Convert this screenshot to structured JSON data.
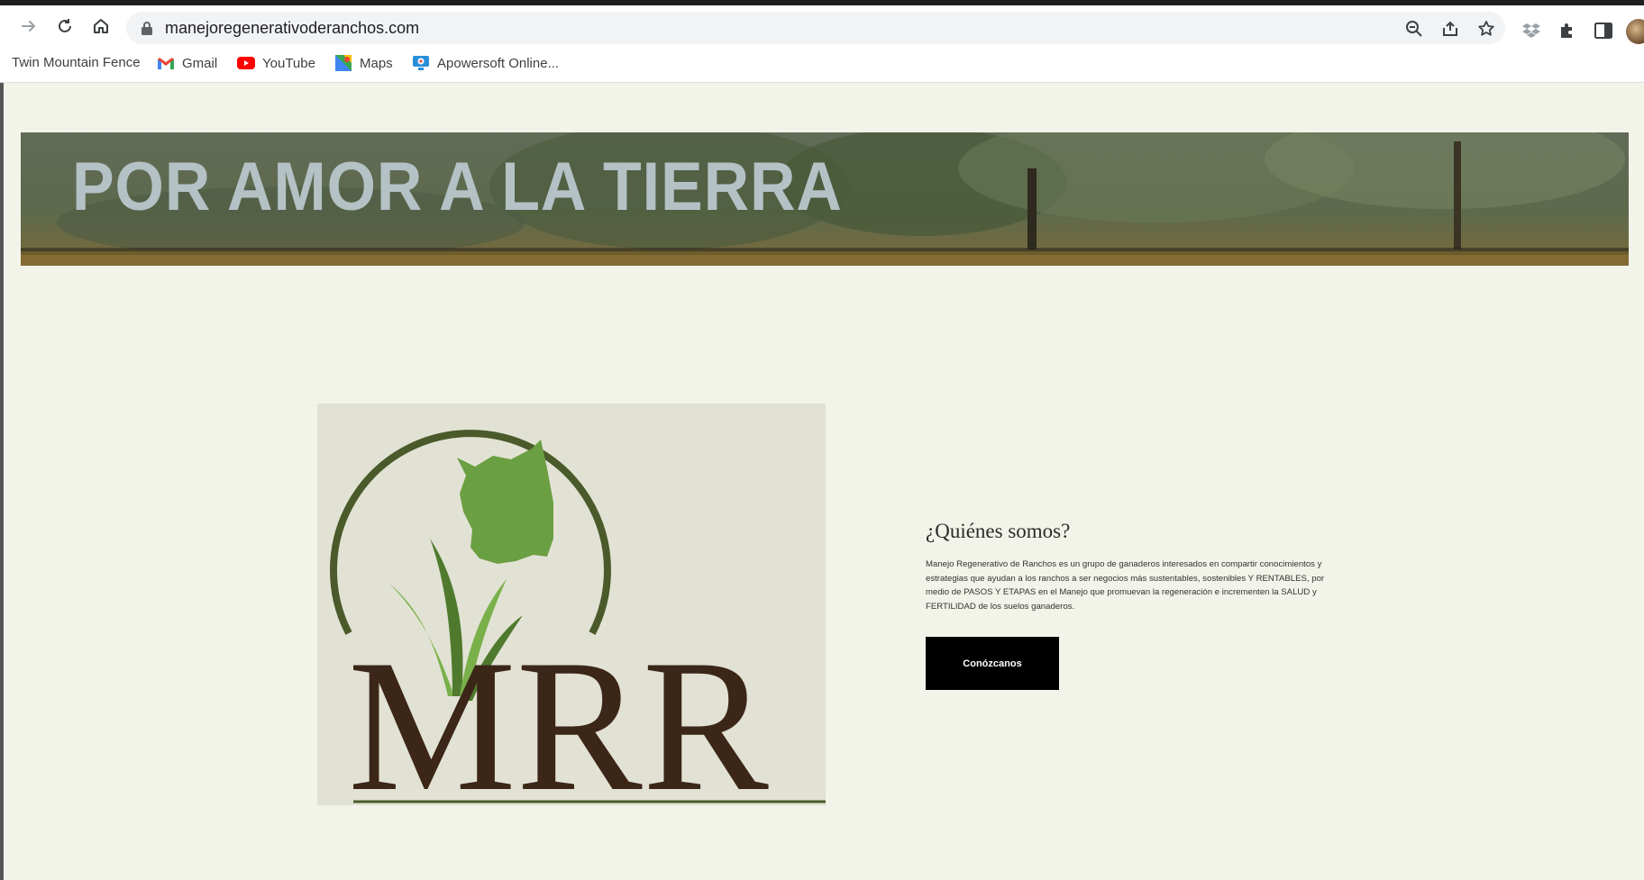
{
  "browser": {
    "url": "manejoregenerativoderanchos.com",
    "nav_icons": [
      "forward-icon",
      "reload-icon",
      "home-icon"
    ],
    "omnibox_icons": [
      "zoom-icon",
      "share-icon",
      "bookmark-star-icon"
    ],
    "extension_icons": [
      "dropbox-icon",
      "extensions-puzzle-icon",
      "side-panel-icon"
    ]
  },
  "bookmarks": [
    {
      "label": "Twin Mountain Fence",
      "icon": "none"
    },
    {
      "label": "Gmail",
      "icon": "gmail-icon"
    },
    {
      "label": "YouTube",
      "icon": "youtube-icon"
    },
    {
      "label": "Maps",
      "icon": "maps-icon"
    },
    {
      "label": "Apowersoft Online...",
      "icon": "apowersoft-icon"
    }
  ],
  "banner": {
    "title": "POR AMOR A LA TIERRA"
  },
  "logo": {
    "text": "MRR",
    "colors": {
      "ring": "#4a5a2a",
      "cow": "#6a9f42",
      "grass_light": "#7ab04a",
      "grass_dark": "#4f7a2e",
      "letters": "#3b2618"
    }
  },
  "about": {
    "title": "¿Quiénes somos?",
    "text": "Manejo Regenerativo de Ranchos es un grupo de ganaderos interesados en compartir conocimientos y estrategias que ayudan a los ranchos a ser negocios más sustentables, sostenibles Y RENTABLES, por medio de PASOS Y ETAPAS en el Manejo que promuevan la regeneración e incrementen la SALUD y FERTILIDAD de los suelos ganaderos.",
    "button_label": "Conózcanos"
  },
  "colors": {
    "page_bg": "#f2f3e9",
    "button_bg": "#000000",
    "banner_text": "#b4c2c6"
  }
}
